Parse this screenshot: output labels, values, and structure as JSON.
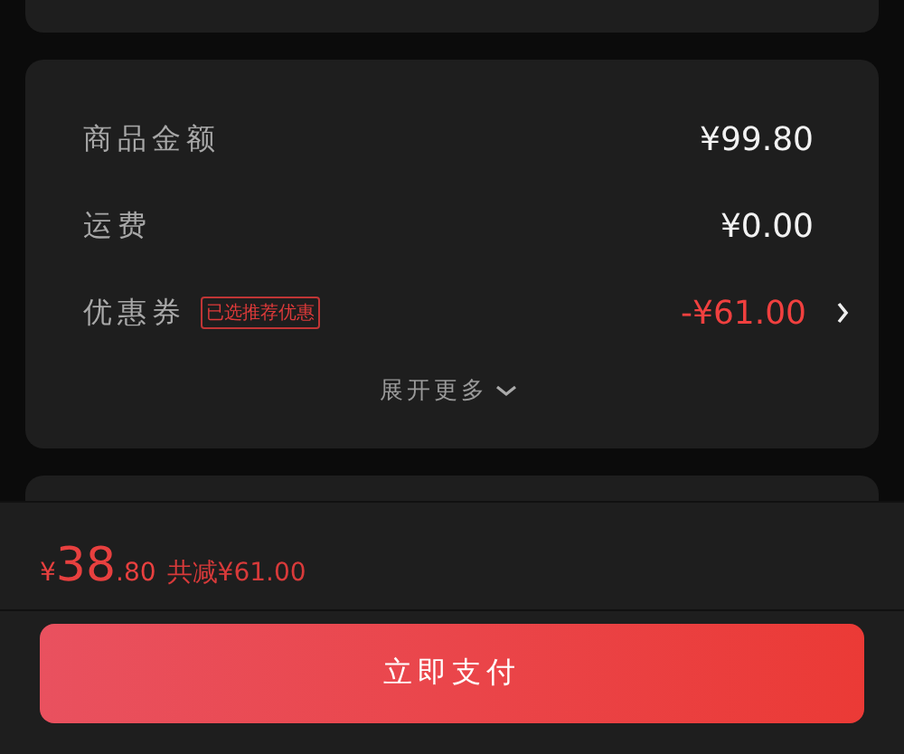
{
  "summary": {
    "rows": [
      {
        "label": "商品金额",
        "value": "¥99.80",
        "kind": "plain"
      },
      {
        "label": "运费",
        "value": "¥0.00",
        "kind": "plain"
      },
      {
        "label": "优惠券",
        "badge": "已选推荐优惠",
        "value": "-¥61.00",
        "kind": "discount"
      }
    ],
    "expand": "展开更多"
  },
  "footer": {
    "currency": "¥",
    "integer": "38",
    "decimal": ".80",
    "saving": "共减¥61.00",
    "pay_button": "立即支付"
  }
}
